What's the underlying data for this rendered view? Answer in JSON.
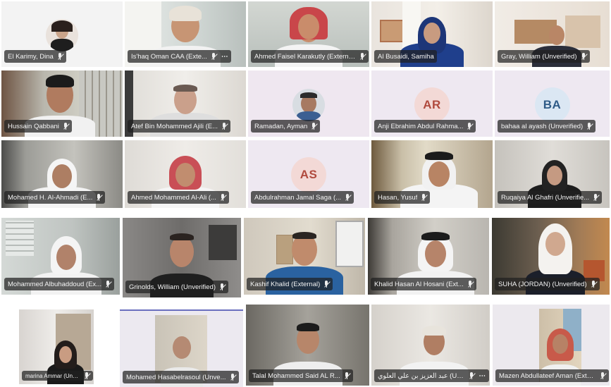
{
  "participants": [
    {
      "name": "El Karimy, Dina",
      "avatar": "photo-circle"
    },
    {
      "name": "Is'haq Oman CAA (Exte...",
      "more": "⋯"
    },
    {
      "name": "Ahmed Faisel Karakutly (External)"
    },
    {
      "name": "Al Busaidi, Samiha"
    },
    {
      "name": "Gray, William (Unverified)"
    },
    {
      "name": "Hussain Qabbani"
    },
    {
      "name": "Atef Bin Mohammed Ajili (E..."
    },
    {
      "name": "Ramadan, Ayman",
      "avatar": "photo-circle"
    },
    {
      "name": "Anji Ebrahim Abdul Rahma...",
      "initials": "AR"
    },
    {
      "name": "bahaa al ayash (Unverified)",
      "initials": "BA"
    },
    {
      "name": "Mohamed H. Al-Ahmadi (E..."
    },
    {
      "name": "Ahmed Mohammed Al-Ali (..."
    },
    {
      "name": "Abdulrahman Jamal Saga (...",
      "initials": "AS"
    },
    {
      "name": "Hasan, Yusuf"
    },
    {
      "name": "Ruqaiya Al Ghafri (Unverifie..."
    },
    {
      "name": "Mohammed Albuhaddoud (Ex..."
    },
    {
      "name": "Grinolds, William (Unverified)"
    },
    {
      "name": "Kashif Khalid (External)"
    },
    {
      "name": "Khalid Hasan Al Hosani (Ext..."
    },
    {
      "name": "SUHA (JORDAN) (Unverified)"
    },
    {
      "name": "marina Ammar (Unverified)"
    },
    {
      "name": "Mohamed Hasabelrasoul (Unve..."
    },
    {
      "name": "Talal Mohammed Said AL R..."
    },
    {
      "name": "عبد العزيز بن علي العلوي (Unverified)",
      "more": "⋯"
    },
    {
      "name": "Mazen Abdullateef Aman (External)"
    }
  ],
  "colors": {
    "initials_bg": "#f3d9d6",
    "initials_fg": "#b04a3e",
    "initials_bg_ba": "#dbe7f3",
    "initials_fg_ba": "#2f5b87",
    "label_bg": "#202020"
  }
}
